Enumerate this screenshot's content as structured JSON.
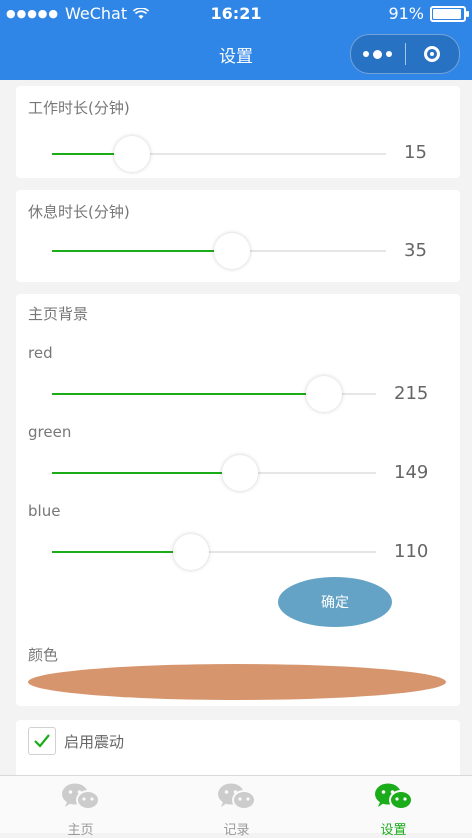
{
  "status_bar": {
    "carrier": "WeChat",
    "time": "16:21",
    "battery": "91%",
    "battery_level": 0.91
  },
  "nav": {
    "title": "设置"
  },
  "work_card": {
    "label": "工作时长(分钟)",
    "value": "15",
    "fraction": 0.24
  },
  "rest_card": {
    "label": "休息时长(分钟)",
    "value": "35",
    "fraction": 0.54
  },
  "bg_card": {
    "label": "主页背景",
    "red": {
      "label": "red",
      "value": "215",
      "fraction": 0.84
    },
    "green": {
      "label": "green",
      "value": "149",
      "fraction": 0.58
    },
    "blue": {
      "label": "blue",
      "value": "110",
      "fraction": 0.43
    },
    "confirm_label": "确定",
    "confirm_color": "#64a3c5",
    "color_label": "颜色",
    "preview_color": "#d7956e"
  },
  "vibrate": {
    "label": "启用震动",
    "checked": true
  },
  "tabbar": {
    "tabs": [
      {
        "label": "主页",
        "active": false
      },
      {
        "label": "记录",
        "active": false
      },
      {
        "label": "设置",
        "active": true
      }
    ],
    "accent": "#1aad19",
    "inactive_color": "#cccccc"
  }
}
